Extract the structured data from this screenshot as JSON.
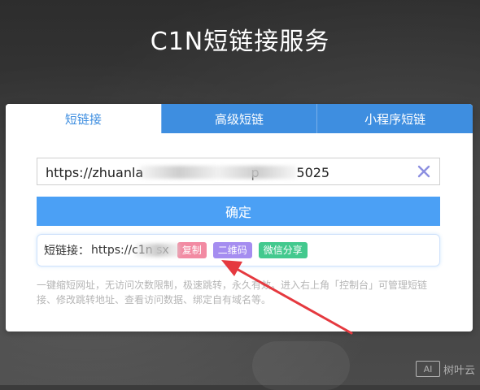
{
  "header": {
    "title": "C1N短链接服务"
  },
  "tabs": [
    {
      "label": "短链接",
      "active": true
    },
    {
      "label": "高级短链",
      "active": false
    },
    {
      "label": "小程序短链",
      "active": false
    }
  ],
  "url_input": {
    "value": "https://zhuanla                          p         5025"
  },
  "confirm_button": {
    "label": "确定"
  },
  "result": {
    "label": "短链接：",
    "short_url": "https://c1n            sx",
    "copy": "复制",
    "qr": "二维码",
    "wechat": "微信分享"
  },
  "description": "一键缩短网址，无访问次数限制，极速跳转，永久有效。进入右上角「控制台」可管理短链接、修改跳转地址、查看访问数据、绑定自有域名等。",
  "watermark": {
    "logo": "AI",
    "text": "树叶云"
  },
  "colors": {
    "accent": "#3e8ee0",
    "button": "#4ba0f5",
    "copy": "#f28aa2",
    "qr": "#a58df0",
    "wechat": "#43c98e",
    "arrow": "#e5393f"
  }
}
